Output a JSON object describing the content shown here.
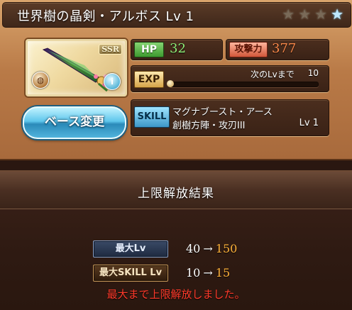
{
  "weapon": {
    "name": "世界樹の晶剣・アルボス Lv 1",
    "rarity_badge": "SSR",
    "stars_total": 4,
    "stars_lit": 1,
    "element_icon": "earth-element-icon",
    "skill_type_icon": "info-icon"
  },
  "actions": {
    "change_base_label": "ベース変更"
  },
  "stats": {
    "hp_label": "HP",
    "hp_value": "32",
    "atk_label": "攻撃力",
    "atk_value": "377",
    "exp_label": "EXP",
    "exp_next_label": "次のLvまで",
    "exp_next_value": "10",
    "exp_progress": 0.0
  },
  "skill": {
    "label": "SKILL",
    "line1": "マグナブースト・アース",
    "line2": "創樹方陣・攻刃III",
    "level": "Lv 1"
  },
  "result": {
    "title": "上限解放結果",
    "max_lv_label": "最大Lv",
    "max_lv_from": "40",
    "max_lv_to": "150",
    "max_skill_label": "最大SKILL Lv",
    "max_skill_from": "10",
    "max_skill_to": "15",
    "arrow": "→",
    "message": "最大まで上限解放しました。"
  },
  "colors": {
    "value_increase": "#ffb23a",
    "message": "#ff3a2a",
    "hp": "#8ff078",
    "atk": "#ff8a4a"
  }
}
